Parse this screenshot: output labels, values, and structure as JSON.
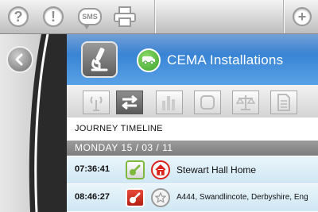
{
  "toolbar": {
    "help_glyph": "?",
    "info_glyph": "!",
    "sms_label": "SMS",
    "add_glyph": "+"
  },
  "header": {
    "title": "CEMA Installations"
  },
  "journey": {
    "section_title": "JOURNEY TIMELINE",
    "date_label": "MONDAY 15 / 03 / 11",
    "entries": [
      {
        "time": "07:36:41",
        "location": "Stewart Hall Home"
      },
      {
        "time": "08:46:27",
        "location": "A444, Swandlincote, Derbyshire, Eng"
      }
    ]
  },
  "colors": {
    "header_blue": "#3b86d6",
    "van_green": "#3aa22a",
    "home_red": "#d9231c",
    "row_blue": "#d8ecf6"
  }
}
